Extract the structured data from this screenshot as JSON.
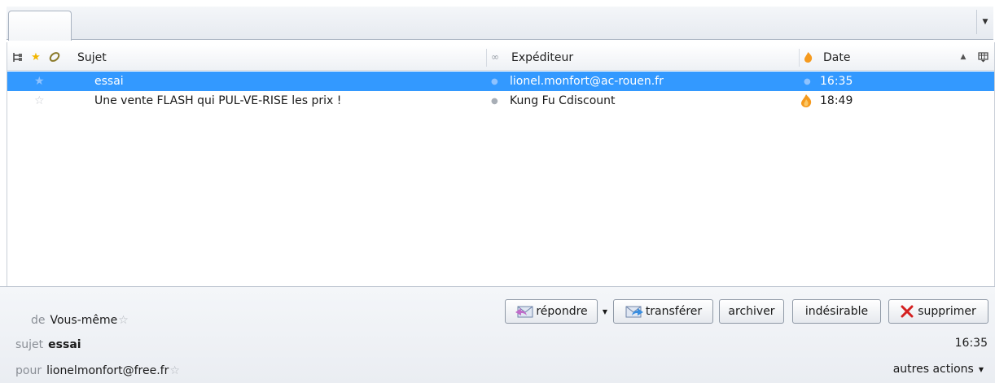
{
  "columns": {
    "subject": "Sujet",
    "sender": "Expéditeur",
    "date": "Date"
  },
  "messages": [
    {
      "subject": "essai",
      "sender": "lionel.monfort@ac-rouen.fr",
      "date": "16:35",
      "selected": true,
      "junk": false
    },
    {
      "subject": "Une vente FLASH qui PUL-VE-RISE les prix !",
      "sender": "Kung Fu Cdiscount",
      "date": "18:49",
      "selected": false,
      "junk": true
    }
  ],
  "header": {
    "from_label": "de",
    "from_value": "Vous-même",
    "subject_label": "sujet",
    "subject_value": "essai",
    "to_label": "pour",
    "to_value": "lionelmonfort@free.fr",
    "time": "16:35"
  },
  "actions": {
    "reply": "répondre",
    "forward": "transférer",
    "archive": "archiver",
    "junk": "indésirable",
    "delete": "supprimer",
    "more": "autres actions"
  },
  "icons": {
    "thread": "thread-icon",
    "star": "star-icon",
    "attachment": "attachment-icon",
    "read_status": "read-status-icon",
    "junk": "junk-flame-icon",
    "column_picker": "column-picker-icon",
    "sort": "sort-ascending-icon"
  },
  "colors": {
    "selection": "#3399ff",
    "junk_flame": "#f59a1e",
    "delete_x": "#d42020"
  }
}
